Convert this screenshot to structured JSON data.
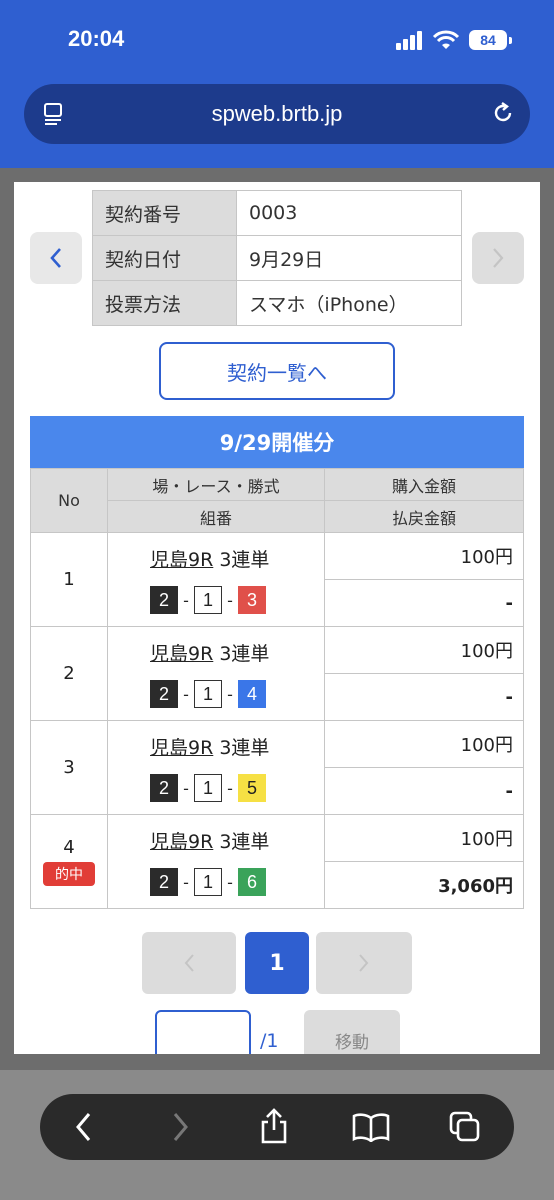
{
  "status": {
    "time": "20:04",
    "battery": "84"
  },
  "browser": {
    "url": "spweb.brtb.jp"
  },
  "contract": {
    "rows": [
      {
        "label": "契約番号",
        "value": "0003"
      },
      {
        "label": "契約日付",
        "value": "9月29日"
      },
      {
        "label": "投票方法",
        "value": "スマホ（iPhone）"
      }
    ],
    "list_button": "契約一覧へ"
  },
  "section": {
    "title": "9/29開催分",
    "headers": {
      "no": "No",
      "race": "場・レース・勝式",
      "combo": "組番",
      "purchase": "購入金額",
      "payout": "払戻金額"
    },
    "bets": [
      {
        "no": "1",
        "venue": "児島9R",
        "type": "3連単",
        "n1": "2",
        "n2": "1",
        "n3": "3",
        "amount": "100円",
        "payout": "-",
        "hit": ""
      },
      {
        "no": "2",
        "venue": "児島9R",
        "type": "3連単",
        "n1": "2",
        "n2": "1",
        "n3": "4",
        "amount": "100円",
        "payout": "-",
        "hit": ""
      },
      {
        "no": "3",
        "venue": "児島9R",
        "type": "3連単",
        "n1": "2",
        "n2": "1",
        "n3": "5",
        "amount": "100円",
        "payout": "-",
        "hit": ""
      },
      {
        "no": "4",
        "venue": "児島9R",
        "type": "3連単",
        "n1": "2",
        "n2": "1",
        "n3": "6",
        "amount": "100円",
        "payout": "3,060円",
        "hit": "的中"
      }
    ]
  },
  "pager": {
    "current": "1",
    "total": "/1",
    "go": "移動"
  },
  "colors": {
    "accent": "#2f5fd0",
    "header_blue": "#4a87ec",
    "hit_red": "#e13d37"
  }
}
